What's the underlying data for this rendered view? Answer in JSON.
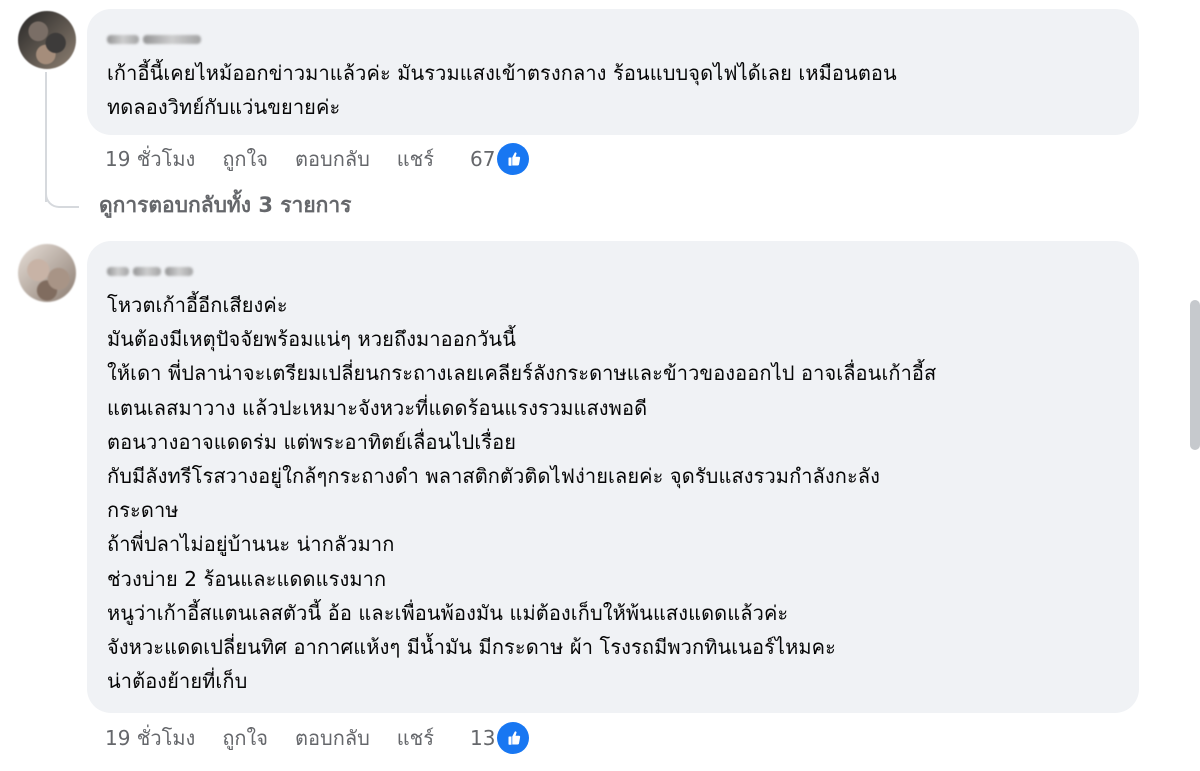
{
  "comments": [
    {
      "avatar_icon": "user-avatar-icon",
      "text": "เก้าอี้นี้เคยไหม้ออกข่าวมาแล้วค่ะ มันรวมแสงเข้าตรงกลาง ร้อนแบบจุดไฟได้เลย เหมือนตอน\nทดลองวิทย์กับแว่นขยายค่ะ",
      "time": "19 ชั่วโมง",
      "like_label": "ถูกใจ",
      "reply_label": "ตอบกลับ",
      "share_label": "แชร์",
      "reaction_count": "67",
      "reaction_icon": "like-icon"
    },
    {
      "avatar_icon": "user-avatar-icon",
      "text": "โหวตเก้าอี้อีกเสียงค่ะ\nมันต้องมีเหตุปัจจัยพร้อมแน่ๆ หวยถึงมาออกวันนี้\nให้เดา พี่ปลาน่าจะเตรียมเปลี่ยนกระถางเลยเคลียร์ลังกระดาษและข้าวของออกไป อาจเลื่อนเก้าอี้ส\nแตนเลสมาวาง แล้วปะเหมาะจังหวะที่แดดร้อนแรงรวมแสงพอดี\nตอนวางอาจแดดร่ม แต่พระอาทิตย์เลื่อนไปเรื่อย\nกับมีลังทรีโรสวางอยู่ใกล้ๆกระถางดำ พลาสติกตัวติดไฟง่ายเลยค่ะ จุดรับแสงรวมกำลังกะลัง\nกระดาษ\nถ้าพี่ปลาไม่อยู่บ้านนะ น่ากลัวมาก\nช่วงบ่าย 2 ร้อนและแดดแรงมาก\nหนูว่าเก้าอี้สแตนเลสตัวนี้ อ้อ และเพื่อนพ้องมัน แม่ต้องเก็บให้พ้นแสงแดดแล้วค่ะ\nจังหวะแดดเปลี่ยนทิศ อากาศแห้งๆ มีน้ำมัน มีกระดาษ ผ้า โรงรถมีพวกทินเนอร์ไหมคะ\nน่าต้องย้ายที่เก็บ",
      "time": "19 ชั่วโมง",
      "like_label": "ถูกใจ",
      "reply_label": "ตอบกลับ",
      "share_label": "แชร์",
      "reaction_count": "13",
      "reaction_icon": "like-icon"
    }
  ],
  "replies_link": "ดูการตอบกลับทั้ง 3 รายการ",
  "colors": {
    "bubble": "#f0f2f5",
    "meta_text": "#65676b",
    "like_blue": "#1877f2",
    "thread_line": "#d6d9dd"
  }
}
